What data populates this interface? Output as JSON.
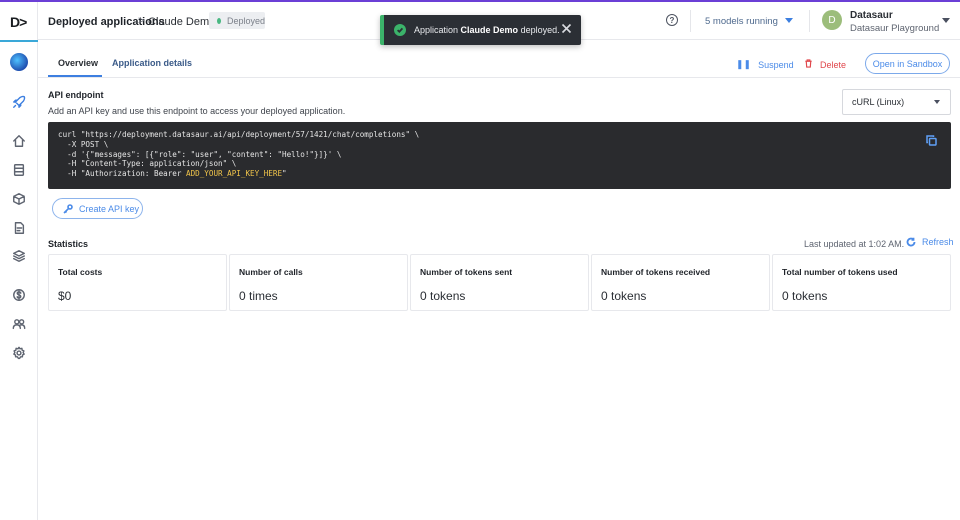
{
  "app": {
    "logo": "D>"
  },
  "header": {
    "breadcrumb_root": "Deployed applications",
    "breadcrumb_sep": ">",
    "breadcrumb_current": "Claude Demo",
    "status_badge": "Deployed",
    "help": "?",
    "models_running": "5 models running",
    "user_initial": "D",
    "user_name": "Datasaur",
    "workspace": "Datasaur Playground"
  },
  "toast": {
    "prefix": "Application",
    "app_name": "Claude Demo",
    "suffix": "deployed."
  },
  "tabs": [
    {
      "label": "Overview",
      "active": true
    },
    {
      "label": "Application details",
      "active": false
    }
  ],
  "actions": {
    "suspend": "Suspend",
    "delete": "Delete",
    "open_sandbox": "Open in Sandbox"
  },
  "api_endpoint": {
    "title": "API endpoint",
    "description": "Add an API key and use this endpoint to access your deployed application.",
    "language_select": "cURL (Linux)",
    "code_lines": [
      "curl \"https://deployment.datasaur.ai/api/deployment/57/1421/chat/completions\" \\",
      "  -X POST \\",
      "  -d '{\"messages\": [{\"role\": \"user\", \"content\": \"Hello!\"}]}' \\",
      "  -H \"Content-Type: application/json\" \\",
      "  -H \"Authorization: Bearer "
    ],
    "api_key_placeholder": "ADD_YOUR_API_KEY_HERE",
    "code_tail": "\"",
    "create_api_key": "Create API key"
  },
  "statistics": {
    "title": "Statistics",
    "last_updated": "Last updated at 1:02 AM.",
    "refresh": "Refresh",
    "cards": [
      {
        "label": "Total costs",
        "value": "$0"
      },
      {
        "label": "Number of calls",
        "value": "0 times"
      },
      {
        "label": "Number of tokens sent",
        "value": "0 tokens"
      },
      {
        "label": "Number of tokens received",
        "value": "0 tokens"
      },
      {
        "label": "Total number of tokens used",
        "value": "0 tokens"
      }
    ]
  },
  "sidebar": {
    "icons": [
      "globe-avatar-icon",
      "rocket-icon",
      "home-icon",
      "database-icon",
      "cube-icon",
      "edit-document-icon",
      "stack-icon",
      "dollar-icon",
      "team-icon",
      "gear-icon"
    ]
  },
  "colors": {
    "accent": "#3d7fe0",
    "danger": "#e0474c",
    "success": "#3bb36a",
    "brand_line": "#6b3fd6",
    "code_bg": "#2a2b2e",
    "code_highlight": "#f0c44a"
  }
}
